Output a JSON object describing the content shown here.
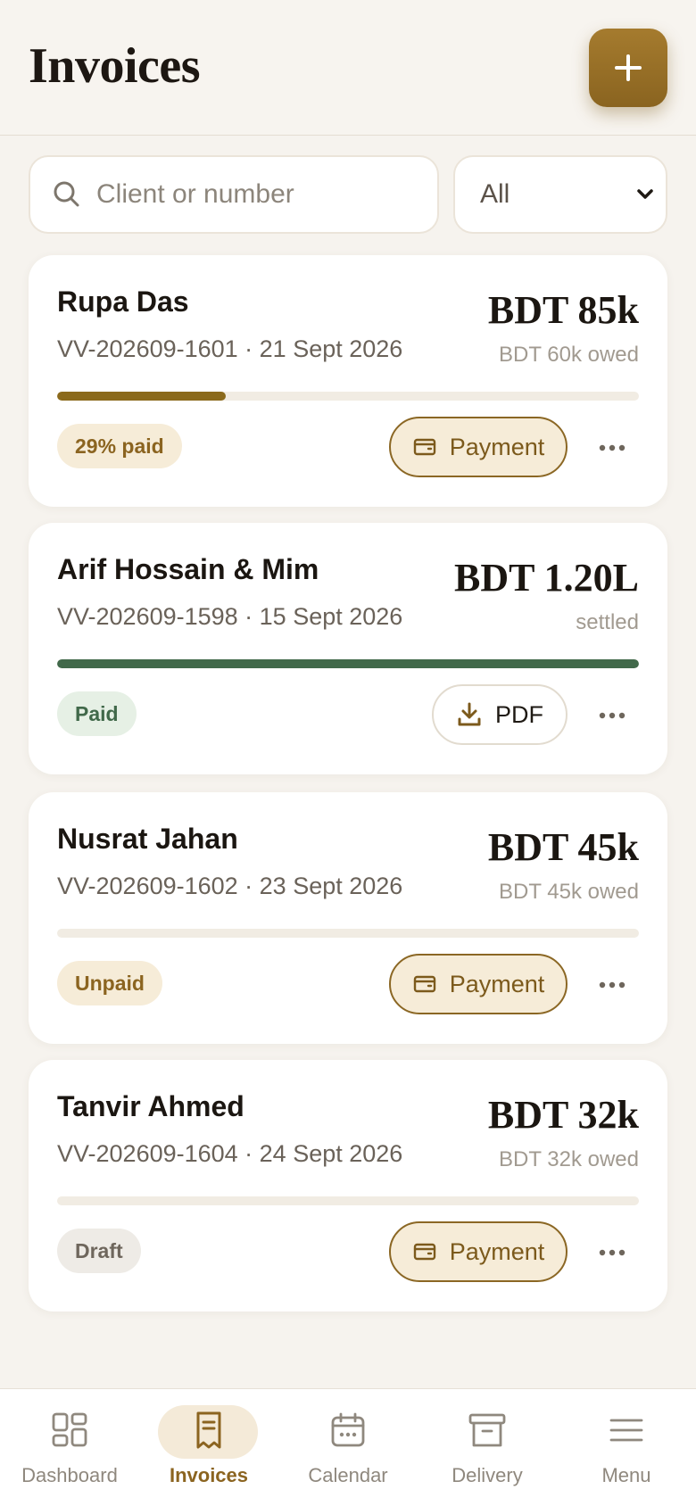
{
  "header": {
    "title": "Invoices"
  },
  "search": {
    "placeholder": "Client or number"
  },
  "filter": {
    "value": "All"
  },
  "colors": {
    "accent": "#8b6420",
    "paid_green": "#41694a",
    "progress_gold": "#8b6a1c",
    "track": "#f1ece3"
  },
  "invoices": [
    {
      "client": "Rupa Das",
      "number_date": "VV-202609-1601 · 21 Sept 2026",
      "amount": "BDT 85k",
      "owed": "BDT 60k owed",
      "paid_fraction": 0.29,
      "status": "29% paid",
      "action": "Payment",
      "action_icon": "wallet-icon"
    },
    {
      "client": "Arif Hossain & Mim",
      "number_date": "VV-202609-1598 · 15 Sept 2026",
      "amount": "BDT 1.20L",
      "owed": "settled",
      "paid_fraction": 1.0,
      "status": "Paid",
      "action": "PDF",
      "action_icon": "download-icon"
    },
    {
      "client": "Nusrat Jahan",
      "number_date": "VV-202609-1602 · 23 Sept 2026",
      "amount": "BDT 45k",
      "owed": "BDT 45k owed",
      "paid_fraction": 0,
      "status": "Unpaid",
      "action": "Payment",
      "action_icon": "wallet-icon"
    },
    {
      "client": "Tanvir Ahmed",
      "number_date": "VV-202609-1604 · 24 Sept 2026",
      "amount": "BDT 32k",
      "owed": "BDT 32k owed",
      "paid_fraction": 0,
      "status": "Draft",
      "action": "Payment",
      "action_icon": "wallet-icon"
    }
  ],
  "nav": {
    "items": [
      {
        "label": "Dashboard",
        "icon": "dashboard-icon"
      },
      {
        "label": "Invoices",
        "icon": "invoice-icon",
        "active": true
      },
      {
        "label": "Calendar",
        "icon": "calendar-icon"
      },
      {
        "label": "Delivery",
        "icon": "archive-box-icon"
      },
      {
        "label": "Menu",
        "icon": "menu-icon"
      }
    ]
  }
}
